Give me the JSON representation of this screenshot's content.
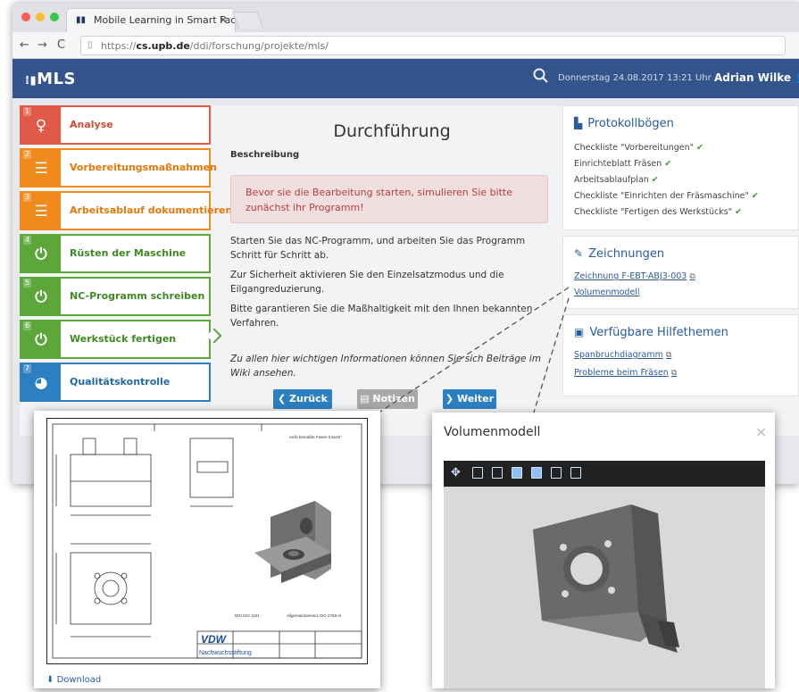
{
  "browser": {
    "tab_title": "Mobile Learning in Smart Fact",
    "tab_close": "×",
    "url_prefix": "https://",
    "url_domain": "cs.upb.de",
    "url_path": "/ddi/forschung/projekte/mls/",
    "back": "←",
    "forward": "→",
    "reload": "C"
  },
  "header": {
    "logo": "MLS",
    "date": "Donnerstag 24.08.2017 13:21 Uhr",
    "user": "Adrian Wilke"
  },
  "steps": [
    {
      "num": "1",
      "label": "Analyse",
      "icon": "lightbulb-icon",
      "color": "#e15a47"
    },
    {
      "num": "2",
      "label": "Vorbereitungsmaßnahmen",
      "icon": "list-icon",
      "color": "#f08a1c"
    },
    {
      "num": "3",
      "label": "Arbeitsablauf dokumentieren",
      "icon": "list-icon",
      "color": "#f08a1c"
    },
    {
      "num": "4",
      "label": "Rüsten der Maschine",
      "icon": "power-icon",
      "color": "#5ca63a"
    },
    {
      "num": "5",
      "label": "NC-Programm schreiben",
      "icon": "power-icon",
      "color": "#5ca63a"
    },
    {
      "num": "6",
      "label": "Werkstück fertigen",
      "icon": "power-icon",
      "color": "#5ca63a"
    },
    {
      "num": "7",
      "label": "Qualitätskontrolle",
      "icon": "pie-chart-icon",
      "color": "#2c7fc0"
    }
  ],
  "main": {
    "title": "Durchführung",
    "section_label": "Beschreibung",
    "alert": "Bevor sie die Bearbeitung starten, simulieren Sie bitte zunächst ihr Programm!",
    "paragraphs": [
      "Starten Sie das NC-Programm, und arbeiten Sie das Programm Schritt für Schritt ab.",
      "Zur Sicherheit aktivieren Sie den Einzelsatzmodus und die Eilgangreduzierung.",
      "Bitte garantieren Sie die Maßhaltigkeit mit den Ihnen bekannten Verfahren."
    ],
    "wiki_note": "Zu allen hier wichtigen Informationen können Sie sich Beiträge im Wiki ansehen.",
    "btn_back": "❮ Zurück",
    "btn_notes": "Notizen",
    "btn_next": "❯ Weiter"
  },
  "sidebar": {
    "protocol_title": "Protokollbögen",
    "protocol_items": [
      "Checkliste \"Vorbereitungen\"",
      "Einrichteblatt Fräsen",
      "Arbeitsablaufplan",
      "Checkliste \"Einrichten der Fräsmaschine\"",
      "Checkliste \"Fertigen des Werkstücks\""
    ],
    "drawings_title": "Zeichnungen",
    "drawings_items": [
      "Zeichnung F-EBT-ABJ3-003",
      "Volumenmodell"
    ],
    "help_title": "Verfügbare Hilfethemen",
    "help_items": [
      "Spanbruchdiagramm",
      "Probleme beim Fräsen"
    ]
  },
  "drawing_popup": {
    "download": "Download",
    "sheet_note": "nicht bemaßte Fasen 0.5x45°",
    "tol_text": "DIN ISO 1101",
    "gen_tol": "Allgemeintoleranz ISO 2768-m",
    "vdw": "VDW",
    "vdw_sub": "Nachwuchsstiftung"
  },
  "volume_popup": {
    "title": "Volumenmodell",
    "close": "×"
  }
}
